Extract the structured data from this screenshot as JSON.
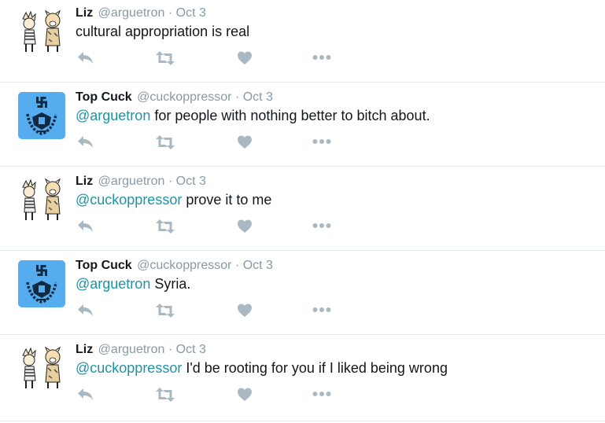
{
  "colors": {
    "mention": "#1b95a8",
    "secondary_text": "#8899a6",
    "action_icon": "#aab8c2",
    "divider": "#e6ecf0",
    "avatar_blue": "#55acee"
  },
  "actions": [
    "reply-icon",
    "retweet-icon",
    "like-icon",
    "more-icon"
  ],
  "tweets": [
    {
      "name": "Liz",
      "handle": "@arguetron",
      "separator": "·",
      "time": "Oct 3",
      "avatar": "calvin-hobbes-avatar",
      "mention": "",
      "text": "cultural appropriation is real"
    },
    {
      "name": "Top Cuck",
      "handle": "@cuckoppressor",
      "separator": "·",
      "time": "Oct 3",
      "avatar": "emblem-avatar",
      "mention": "@arguetron",
      "text": " for people with nothing better to bitch about."
    },
    {
      "name": "Liz",
      "handle": "@arguetron",
      "separator": "·",
      "time": "Oct 3",
      "avatar": "calvin-hobbes-avatar",
      "mention": "@cuckoppressor",
      "text": " prove it to me"
    },
    {
      "name": "Top Cuck",
      "handle": "@cuckoppressor",
      "separator": "·",
      "time": "Oct 3",
      "avatar": "emblem-avatar",
      "mention": "@arguetron",
      "text": " Syria."
    },
    {
      "name": "Liz",
      "handle": "@arguetron",
      "separator": "·",
      "time": "Oct 3",
      "avatar": "calvin-hobbes-avatar",
      "mention": "@cuckoppressor",
      "text": " I'd be rooting for you if I liked being wrong"
    }
  ]
}
